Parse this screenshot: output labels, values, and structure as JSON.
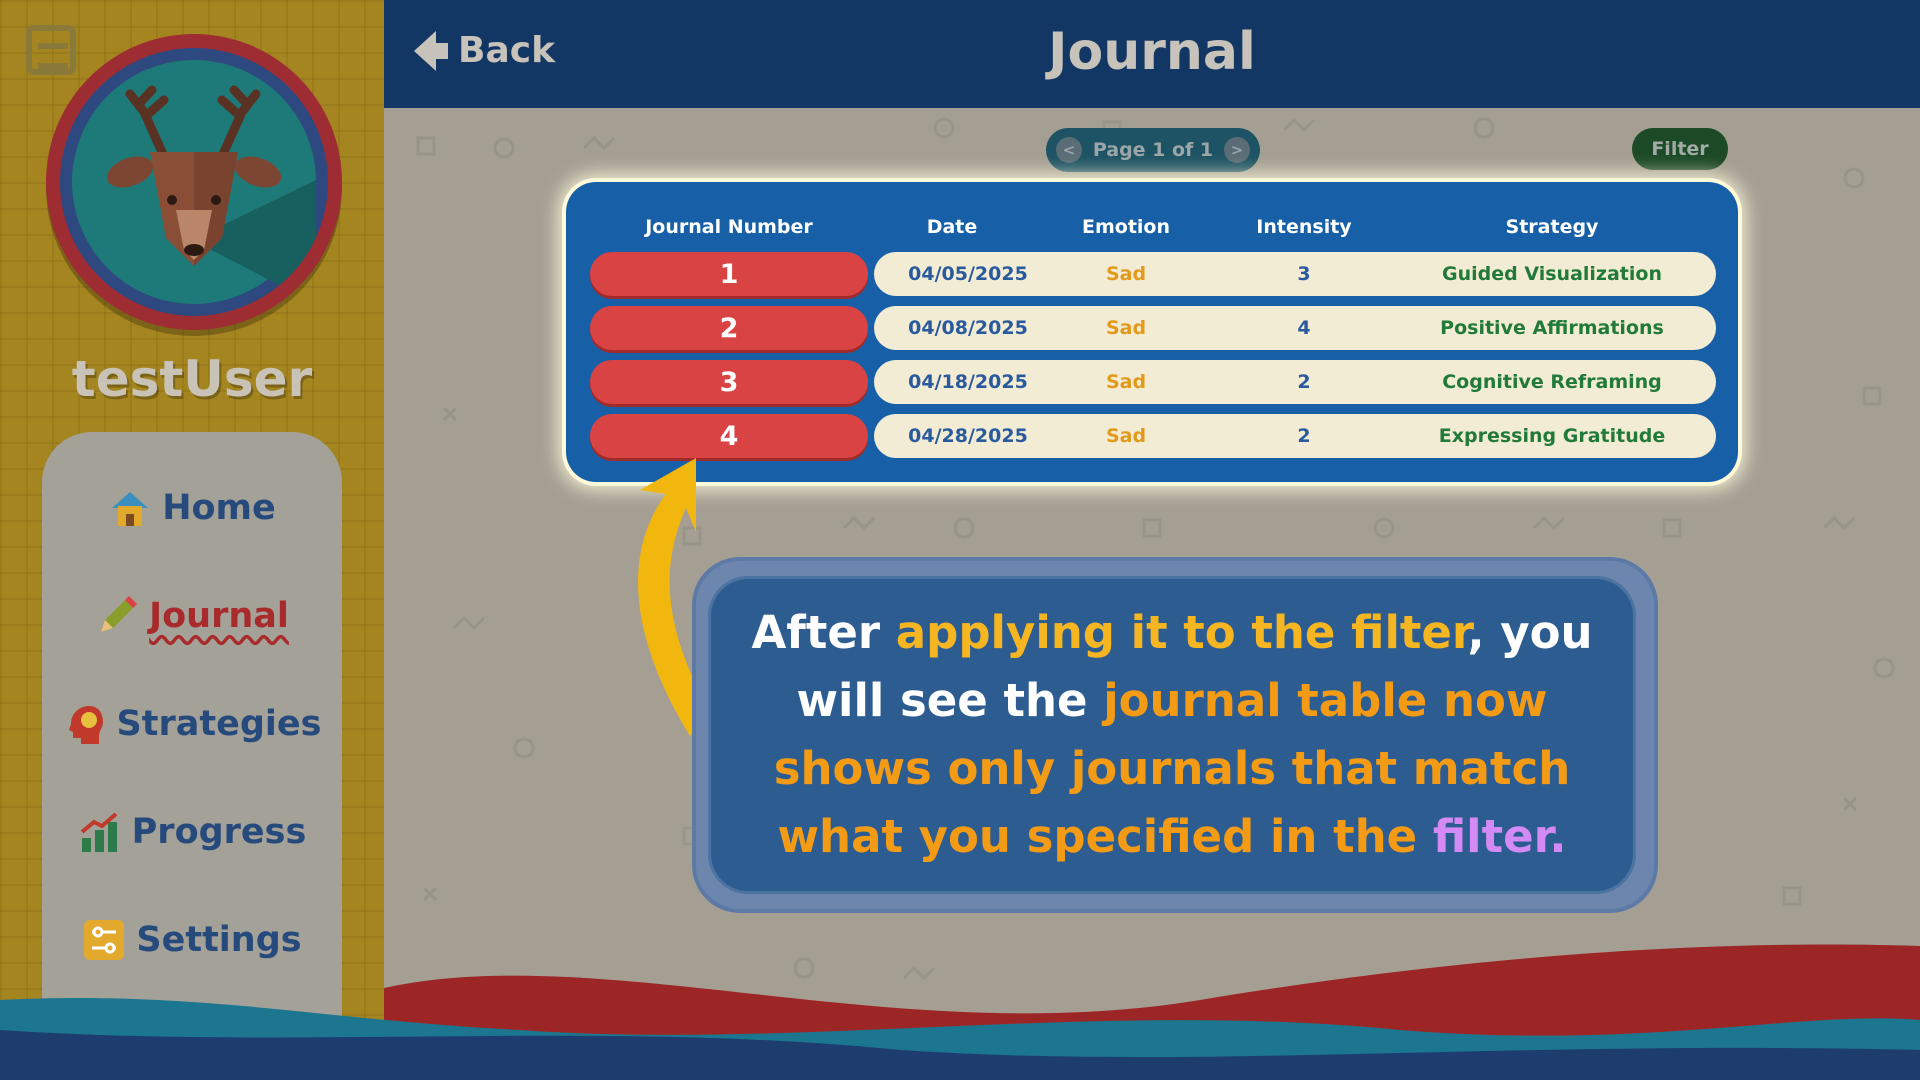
{
  "sidebar": {
    "username": "testUser",
    "nav": [
      {
        "label": "Home",
        "icon": "home-icon"
      },
      {
        "label": "Journal",
        "icon": "pencil-icon",
        "active": true
      },
      {
        "label": "Strategies",
        "icon": "head-icon"
      },
      {
        "label": "Progress",
        "icon": "bar-chart-icon"
      },
      {
        "label": "Settings",
        "icon": "sliders-icon"
      }
    ]
  },
  "header": {
    "back_label": "Back",
    "title": "Journal"
  },
  "pager": {
    "label": "Page 1 of 1",
    "prev": "<",
    "next": ">"
  },
  "filter_label": "Filter",
  "table": {
    "columns": [
      "Journal Number",
      "Date",
      "Emotion",
      "Intensity",
      "Strategy"
    ],
    "rows": [
      {
        "number": "1",
        "date": "04/05/2025",
        "emotion": "Sad",
        "intensity": "3",
        "strategy": "Guided Visualization"
      },
      {
        "number": "2",
        "date": "04/08/2025",
        "emotion": "Sad",
        "intensity": "4",
        "strategy": "Positive Affirmations"
      },
      {
        "number": "3",
        "date": "04/18/2025",
        "emotion": "Sad",
        "intensity": "2",
        "strategy": "Cognitive Reframing"
      },
      {
        "number": "4",
        "date": "04/28/2025",
        "emotion": "Sad",
        "intensity": "2",
        "strategy": "Expressing Gratitude"
      }
    ]
  },
  "callout": {
    "part1": "After ",
    "part2": "applying it to the filter",
    "part3": ", you will see the ",
    "part4": "journal table now shows only journals that match what you specified in the ",
    "part5": "filter."
  },
  "colors": {
    "header": "#123764",
    "table": "#1760a8",
    "number_pill": "#d94343",
    "highlight_yellow": "#f6b622",
    "highlight_orange": "#f49b16",
    "highlight_purple": "#d48af5"
  }
}
